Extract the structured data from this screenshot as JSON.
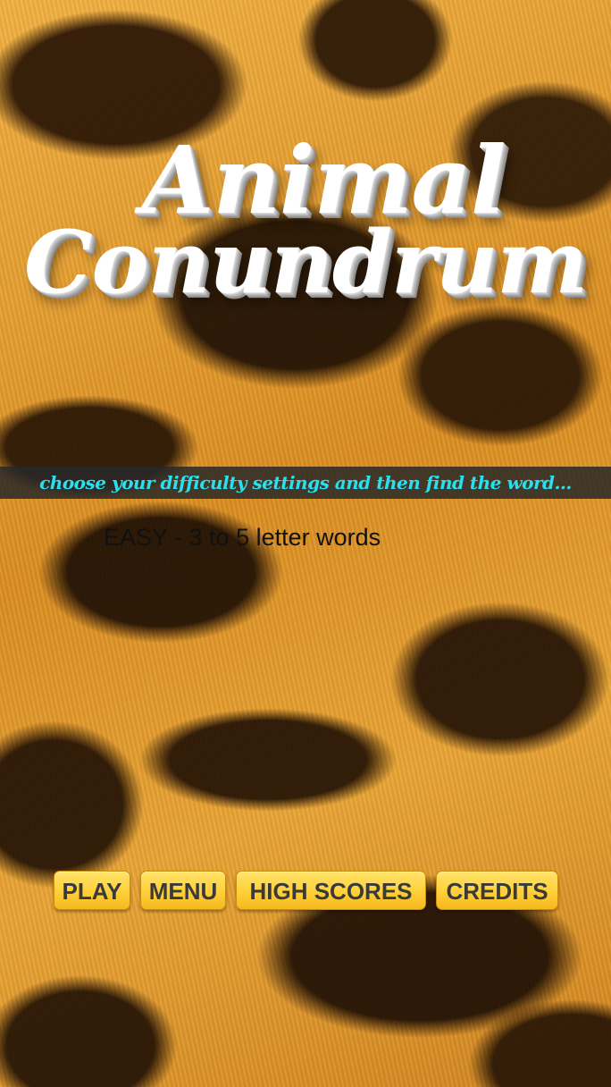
{
  "title": {
    "line1": "Animal",
    "line2": "Conundrum"
  },
  "banner": {
    "text": "choose your difficulty settings and then find the word..."
  },
  "difficulty": {
    "selected": "EASY - 3 to 5 letter words"
  },
  "buttons": {
    "play": "PLAY",
    "menu": "MENU",
    "high_scores": "HIGH SCORES",
    "credits": "CREDITS"
  },
  "colors": {
    "banner_text": "#29e0f0",
    "button_fill": "#ffd23c",
    "background": "leopard-print"
  }
}
